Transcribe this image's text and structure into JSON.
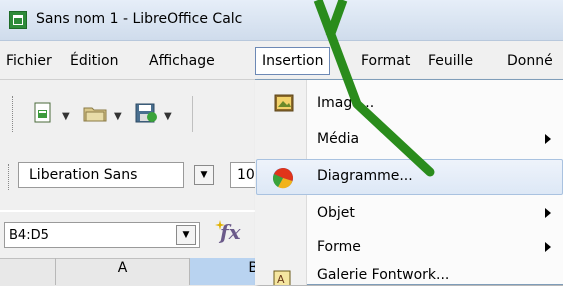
{
  "window": {
    "title": "Sans nom 1 - LibreOffice Calc"
  },
  "menubar": {
    "items": [
      {
        "label": "Fichier",
        "u": "F"
      },
      {
        "label": "Édition",
        "u": "É"
      },
      {
        "label": "Affichage",
        "u": "A"
      },
      {
        "label": "Insertion",
        "u": "I"
      },
      {
        "label": "Format",
        "u": "m"
      },
      {
        "label": "Feuille",
        "u": "F"
      },
      {
        "label": "Donné",
        "u": "D"
      }
    ]
  },
  "toolbar": {
    "font_name": "Liberation Sans",
    "font_size": "10"
  },
  "namebox": {
    "value": "B4:D5"
  },
  "columns": [
    "A",
    "B"
  ],
  "insert_menu": {
    "items": [
      {
        "label": "Image...",
        "submenu": false,
        "icon": "image-icon"
      },
      {
        "label": "Média",
        "submenu": true,
        "icon": ""
      },
      {
        "label": "Diagramme...",
        "submenu": false,
        "icon": "pie-chart-icon",
        "highlighted": true
      },
      {
        "label": "Objet",
        "submenu": true,
        "icon": ""
      },
      {
        "label": "Forme",
        "submenu": true,
        "icon": ""
      },
      {
        "label": "Galerie Fontwork...",
        "submenu": false,
        "icon": "fontwork-icon"
      }
    ]
  },
  "annotation": {
    "color": "#2a8c1c",
    "target": "Diagramme..."
  }
}
